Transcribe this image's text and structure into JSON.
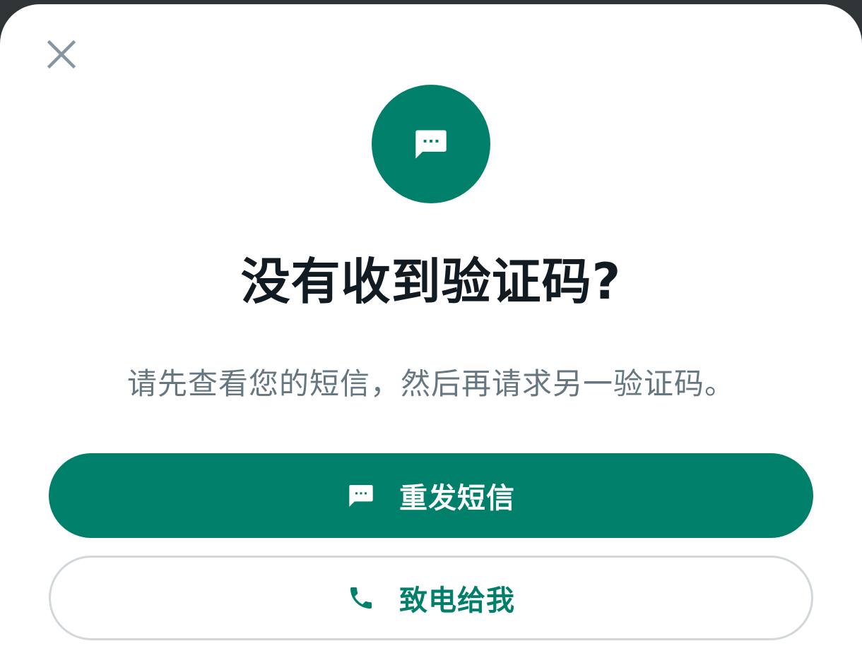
{
  "dialog": {
    "title": "没有收到验证码?",
    "subtitle": "请先查看您的短信，然后再请求另一验证码。"
  },
  "icons": {
    "close": "close-icon",
    "hero": "message-icon",
    "resend": "message-icon",
    "call": "phone-icon"
  },
  "buttons": {
    "resend_sms_label": "重发短信",
    "call_me_label": "致电给我"
  },
  "colors": {
    "accent": "#00806a",
    "title": "#111b21",
    "subtitle": "#667781",
    "close_icon": "#8696a0",
    "outline": "#d1d7db"
  }
}
